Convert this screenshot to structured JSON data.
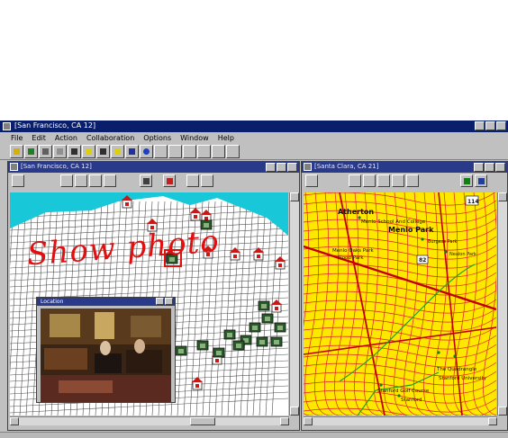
{
  "app": {
    "title": "[San Francisco, CA 12]",
    "menu": [
      "File",
      "Edit",
      "Action",
      "Collaboration",
      "Options",
      "Window",
      "Help"
    ]
  },
  "windows": [
    {
      "title": "[San Francisco, CA 12]"
    },
    {
      "title": "[Santa Clara, CA 21]"
    }
  ],
  "photo_window": {
    "title": "Location"
  },
  "annotation": {
    "text": "Show photo",
    "color": "#e01010"
  },
  "maps": {
    "left": {
      "water": "#18c8d8",
      "land": "#ffffff",
      "streets": "#505050"
    },
    "right": {
      "land": "#ffe800",
      "roads": "#e02020"
    },
    "labels": [
      {
        "text": "Atherton"
      },
      {
        "text": "Menlo Park"
      },
      {
        "text": "Menlo School And College"
      },
      {
        "text": "Burgess Park"
      },
      {
        "text": "Menlo Oaks Park"
      },
      {
        "text": "Flood Park"
      },
      {
        "text": "Nealon Park"
      },
      {
        "text": "The Quadrangle"
      },
      {
        "text": "Stanford University"
      },
      {
        "text": "Stanford Golf Course"
      },
      {
        "text": "Stanford"
      },
      {
        "text": "114"
      },
      {
        "text": "82"
      }
    ]
  }
}
